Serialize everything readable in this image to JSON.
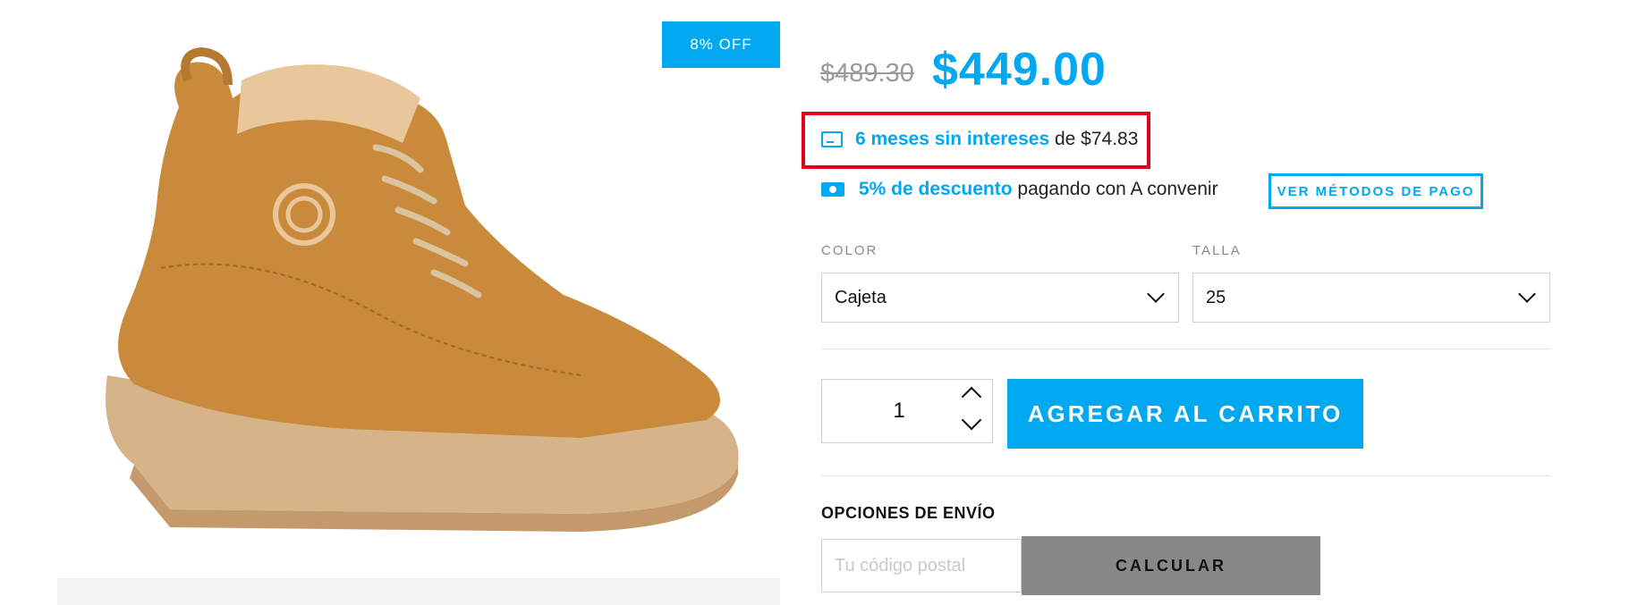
{
  "product": {
    "badge": "8% OFF",
    "old_price": "$489.30",
    "price": "$449.00",
    "image_icon": "boot-product-image"
  },
  "payment": {
    "installments_highlight": "6 meses sin intereses",
    "installments_rest": " de $74.83",
    "discount_highlight": "5% de descuento",
    "discount_rest": " pagando con A convenir",
    "methods_button": "VER MÉTODOS DE PAGO",
    "installments_icon": "credit-card-icon",
    "discount_icon": "cash-icon"
  },
  "variants": {
    "color_label": "COLOR",
    "color_value": "Cajeta",
    "size_label": "TALLA",
    "size_value": "25"
  },
  "cart": {
    "quantity": "1",
    "add_button": "AGREGAR AL CARRITO"
  },
  "shipping": {
    "title": "OPCIONES DE ENVÍO",
    "zip_placeholder": "Tu código postal",
    "calc_button": "CALCULAR"
  },
  "colors": {
    "accent": "#00a8ef",
    "highlight_border": "#e3001b",
    "calc_button_bg": "#888888"
  }
}
